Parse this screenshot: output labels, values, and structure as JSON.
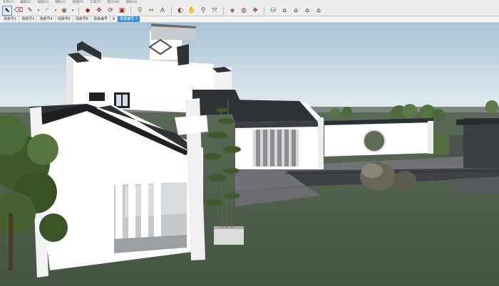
{
  "menu": [
    "文件(F)",
    "编辑(E)",
    "视图(V)",
    "相机(C)",
    "绘图(R)",
    "工具(T)",
    "窗口(W)",
    "帮助(H)"
  ],
  "toolbar": [
    {
      "icon": "select-arrow-icon",
      "glyph": "⬉",
      "color": "#222222",
      "active": true
    },
    {
      "icon": "eraser-icon",
      "glyph": "⌫",
      "color": "#c23a3a"
    },
    {
      "icon": "pencil-icon",
      "glyph": "✎",
      "color": "#b0201e"
    },
    {
      "icon": "caret-down-icon",
      "glyph": "▾",
      "color": "#444444",
      "caret": true
    },
    {
      "icon": "arc-icon",
      "glyph": "◜",
      "color": "#b0201e"
    },
    {
      "icon": "caret-down-icon",
      "glyph": "▾",
      "color": "#444444",
      "caret": true
    },
    {
      "icon": "shape-icon",
      "glyph": "◉",
      "color": "#8a5a2a"
    },
    {
      "icon": "caret-down-icon",
      "glyph": "▾",
      "color": "#444444",
      "caret": true
    },
    {
      "sep": true
    },
    {
      "icon": "push-pull-icon",
      "glyph": "◆",
      "color": "#b0201e"
    },
    {
      "icon": "move-icon",
      "glyph": "✥",
      "color": "#b0201e"
    },
    {
      "icon": "rotate-icon",
      "glyph": "⟳",
      "color": "#b0201e"
    },
    {
      "icon": "scale-icon",
      "glyph": "▣",
      "color": "#b0201e"
    },
    {
      "sep": true
    },
    {
      "icon": "tape-measure-icon",
      "glyph": "⚲",
      "color": "#8a6a1a"
    },
    {
      "icon": "dimension-icon",
      "glyph": "⇔",
      "color": "#8a6a1a"
    },
    {
      "icon": "text-icon",
      "glyph": "A",
      "color": "#5a5a5a"
    },
    {
      "sep": true
    },
    {
      "icon": "orbit-icon",
      "glyph": "◐",
      "color": "#8a3a3a"
    },
    {
      "icon": "pan-icon",
      "glyph": "✋",
      "color": "#8a3a3a"
    },
    {
      "icon": "zoom-icon",
      "glyph": "⚲",
      "color": "#5a5a5a"
    },
    {
      "icon": "zoom-extents-icon",
      "glyph": "⤧",
      "color": "#3a3a3a"
    },
    {
      "sep": true
    },
    {
      "icon": "paint-bucket-icon",
      "glyph": "◈",
      "color": "#8a4a2a"
    },
    {
      "icon": "components-icon",
      "glyph": "◍",
      "color": "#8a3a3a"
    },
    {
      "icon": "materials-icon",
      "glyph": "❖",
      "color": "#8a3a3a"
    },
    {
      "sep": true
    },
    {
      "icon": "warehouse-icon",
      "glyph": "⛁",
      "color": "#5a5a5a"
    },
    {
      "icon": "iso-view-icon",
      "glyph": "⌂",
      "color": "#333333"
    },
    {
      "icon": "top-view-icon",
      "glyph": "⌂",
      "color": "#333333"
    },
    {
      "icon": "front-view-icon",
      "glyph": "⌂",
      "color": "#333333"
    },
    {
      "icon": "side-view-icon",
      "glyph": "⌂",
      "color": "#333333"
    }
  ],
  "scene_tabs": [
    {
      "label": "场景号1"
    },
    {
      "label": "场景号3"
    },
    {
      "label": "场景号4"
    },
    {
      "label": "场景号5"
    },
    {
      "label": "场景号6"
    },
    {
      "label": "场景编号"
    },
    {
      "label": "8"
    },
    {
      "label": "场景编号 7",
      "selected": true
    }
  ],
  "colors": {
    "sky_top": "#a6c0d4",
    "sky_bottom": "#e6edf1",
    "ground": "#4c5a48",
    "wall": "#ffffff",
    "roof": "#2f3134",
    "paving": "#6c6e72",
    "selected_tab": "#3d8fd8"
  }
}
